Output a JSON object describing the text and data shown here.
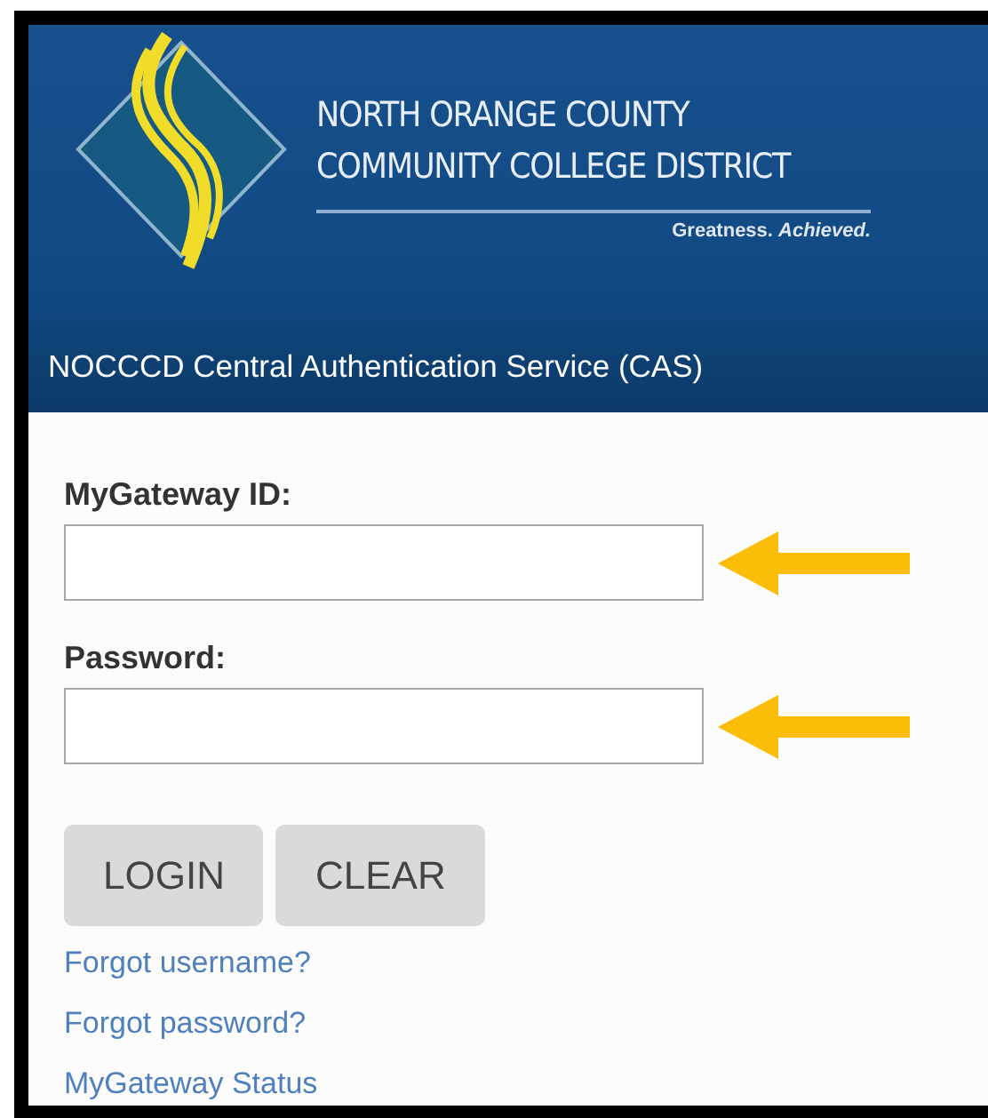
{
  "banner": {
    "org_line_1": "NORTH ORANGE COUNTY",
    "org_line_2": "COMMUNITY COLLEGE DISTRICT",
    "tagline": "Greatness. *Achieved.*",
    "service_title": "NOCCCD Central Authentication Service (CAS)"
  },
  "fields": [
    {
      "label": "MyGateway ID:",
      "annotated": true
    },
    {
      "label": "Password:",
      "annotated": true
    }
  ],
  "buttons": [
    "LOGIN",
    "CLEAR"
  ],
  "links": [
    "Forgot username?",
    "Forgot password?",
    "MyGateway Status"
  ]
}
